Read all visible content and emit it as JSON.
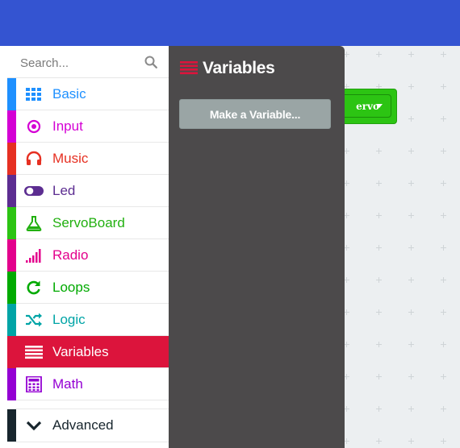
{
  "search": {
    "placeholder": "Search..."
  },
  "categories": [
    {
      "label": "Basic",
      "color": "#1E90FF",
      "icon": "grid-icon"
    },
    {
      "label": "Input",
      "color": "#D400D4",
      "icon": "radio-button-icon"
    },
    {
      "label": "Music",
      "color": "#E63022",
      "icon": "headphones-icon"
    },
    {
      "label": "Led",
      "color": "#5C2D91",
      "icon": "toggle-icon"
    },
    {
      "label": "ServoBoard",
      "color": "#2CC413",
      "icon": "flask-icon"
    },
    {
      "label": "Radio",
      "color": "#E3008C",
      "icon": "signal-bars-icon"
    },
    {
      "label": "Loops",
      "color": "#00AA00",
      "icon": "refresh-icon"
    },
    {
      "label": "Logic",
      "color": "#00A4A6",
      "icon": "shuffle-icon"
    },
    {
      "label": "Variables",
      "color": "#DC143C",
      "icon": "list-icon",
      "selected": true
    },
    {
      "label": "Math",
      "color": "#9400D3",
      "icon": "calculator-icon"
    }
  ],
  "advanced": {
    "label": "Advanced",
    "color": "#17252D",
    "icon": "chevron-down-icon"
  },
  "flyout": {
    "title": "Variables",
    "make_variable_label": "Make a Variable..."
  },
  "workspace": {
    "block_dropdown_text": "ervo",
    "block_color": "#2CC413"
  },
  "colors": {
    "topbar": "#3454D1",
    "flyout_bg": "#4C4A4B",
    "workspace_bg": "#ECEFF1"
  }
}
